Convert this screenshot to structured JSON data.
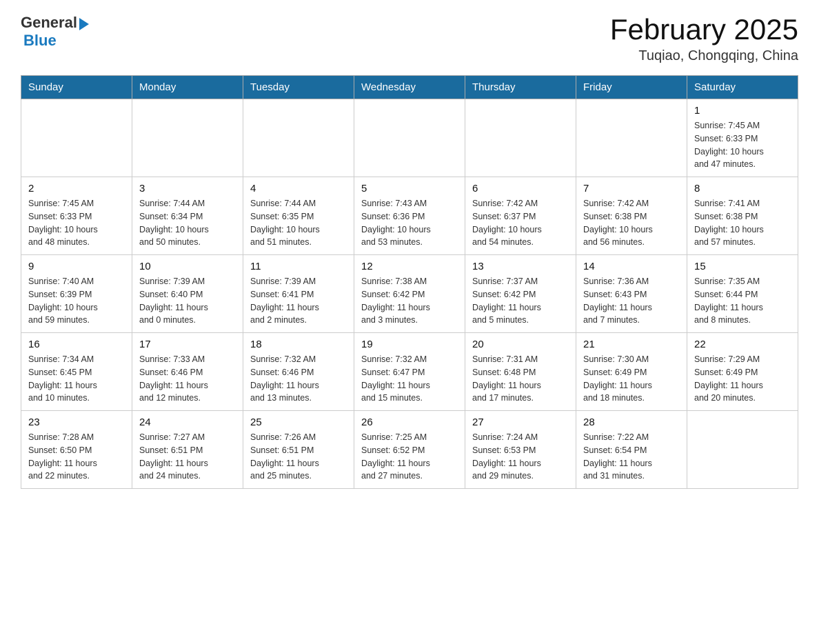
{
  "header": {
    "logo_general": "General",
    "logo_blue": "Blue",
    "month_title": "February 2025",
    "location": "Tuqiao, Chongqing, China"
  },
  "days_of_week": [
    "Sunday",
    "Monday",
    "Tuesday",
    "Wednesday",
    "Thursday",
    "Friday",
    "Saturday"
  ],
  "weeks": [
    [
      {
        "day": "",
        "info": ""
      },
      {
        "day": "",
        "info": ""
      },
      {
        "day": "",
        "info": ""
      },
      {
        "day": "",
        "info": ""
      },
      {
        "day": "",
        "info": ""
      },
      {
        "day": "",
        "info": ""
      },
      {
        "day": "1",
        "info": "Sunrise: 7:45 AM\nSunset: 6:33 PM\nDaylight: 10 hours\nand 47 minutes."
      }
    ],
    [
      {
        "day": "2",
        "info": "Sunrise: 7:45 AM\nSunset: 6:33 PM\nDaylight: 10 hours\nand 48 minutes."
      },
      {
        "day": "3",
        "info": "Sunrise: 7:44 AM\nSunset: 6:34 PM\nDaylight: 10 hours\nand 50 minutes."
      },
      {
        "day": "4",
        "info": "Sunrise: 7:44 AM\nSunset: 6:35 PM\nDaylight: 10 hours\nand 51 minutes."
      },
      {
        "day": "5",
        "info": "Sunrise: 7:43 AM\nSunset: 6:36 PM\nDaylight: 10 hours\nand 53 minutes."
      },
      {
        "day": "6",
        "info": "Sunrise: 7:42 AM\nSunset: 6:37 PM\nDaylight: 10 hours\nand 54 minutes."
      },
      {
        "day": "7",
        "info": "Sunrise: 7:42 AM\nSunset: 6:38 PM\nDaylight: 10 hours\nand 56 minutes."
      },
      {
        "day": "8",
        "info": "Sunrise: 7:41 AM\nSunset: 6:38 PM\nDaylight: 10 hours\nand 57 minutes."
      }
    ],
    [
      {
        "day": "9",
        "info": "Sunrise: 7:40 AM\nSunset: 6:39 PM\nDaylight: 10 hours\nand 59 minutes."
      },
      {
        "day": "10",
        "info": "Sunrise: 7:39 AM\nSunset: 6:40 PM\nDaylight: 11 hours\nand 0 minutes."
      },
      {
        "day": "11",
        "info": "Sunrise: 7:39 AM\nSunset: 6:41 PM\nDaylight: 11 hours\nand 2 minutes."
      },
      {
        "day": "12",
        "info": "Sunrise: 7:38 AM\nSunset: 6:42 PM\nDaylight: 11 hours\nand 3 minutes."
      },
      {
        "day": "13",
        "info": "Sunrise: 7:37 AM\nSunset: 6:42 PM\nDaylight: 11 hours\nand 5 minutes."
      },
      {
        "day": "14",
        "info": "Sunrise: 7:36 AM\nSunset: 6:43 PM\nDaylight: 11 hours\nand 7 minutes."
      },
      {
        "day": "15",
        "info": "Sunrise: 7:35 AM\nSunset: 6:44 PM\nDaylight: 11 hours\nand 8 minutes."
      }
    ],
    [
      {
        "day": "16",
        "info": "Sunrise: 7:34 AM\nSunset: 6:45 PM\nDaylight: 11 hours\nand 10 minutes."
      },
      {
        "day": "17",
        "info": "Sunrise: 7:33 AM\nSunset: 6:46 PM\nDaylight: 11 hours\nand 12 minutes."
      },
      {
        "day": "18",
        "info": "Sunrise: 7:32 AM\nSunset: 6:46 PM\nDaylight: 11 hours\nand 13 minutes."
      },
      {
        "day": "19",
        "info": "Sunrise: 7:32 AM\nSunset: 6:47 PM\nDaylight: 11 hours\nand 15 minutes."
      },
      {
        "day": "20",
        "info": "Sunrise: 7:31 AM\nSunset: 6:48 PM\nDaylight: 11 hours\nand 17 minutes."
      },
      {
        "day": "21",
        "info": "Sunrise: 7:30 AM\nSunset: 6:49 PM\nDaylight: 11 hours\nand 18 minutes."
      },
      {
        "day": "22",
        "info": "Sunrise: 7:29 AM\nSunset: 6:49 PM\nDaylight: 11 hours\nand 20 minutes."
      }
    ],
    [
      {
        "day": "23",
        "info": "Sunrise: 7:28 AM\nSunset: 6:50 PM\nDaylight: 11 hours\nand 22 minutes."
      },
      {
        "day": "24",
        "info": "Sunrise: 7:27 AM\nSunset: 6:51 PM\nDaylight: 11 hours\nand 24 minutes."
      },
      {
        "day": "25",
        "info": "Sunrise: 7:26 AM\nSunset: 6:51 PM\nDaylight: 11 hours\nand 25 minutes."
      },
      {
        "day": "26",
        "info": "Sunrise: 7:25 AM\nSunset: 6:52 PM\nDaylight: 11 hours\nand 27 minutes."
      },
      {
        "day": "27",
        "info": "Sunrise: 7:24 AM\nSunset: 6:53 PM\nDaylight: 11 hours\nand 29 minutes."
      },
      {
        "day": "28",
        "info": "Sunrise: 7:22 AM\nSunset: 6:54 PM\nDaylight: 11 hours\nand 31 minutes."
      },
      {
        "day": "",
        "info": ""
      }
    ]
  ]
}
